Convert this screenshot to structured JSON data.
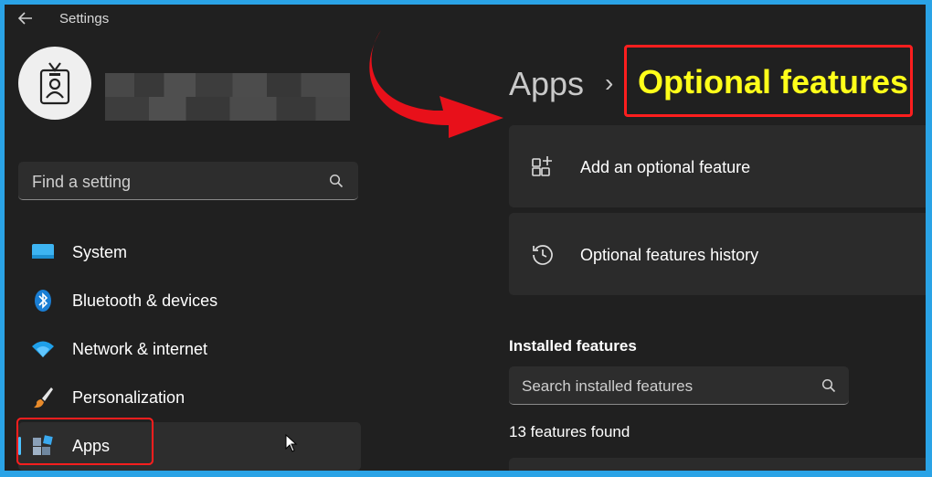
{
  "window": {
    "title": "Settings",
    "back_icon": "arrow-left-icon"
  },
  "user": {
    "avatar_icon": "id-badge-icon"
  },
  "sidebar": {
    "search_placeholder": "Find a setting",
    "items": [
      {
        "label": "System",
        "icon": "monitor-icon",
        "active": false
      },
      {
        "label": "Bluetooth & devices",
        "icon": "bluetooth-icon",
        "active": false
      },
      {
        "label": "Network & internet",
        "icon": "wifi-icon",
        "active": false
      },
      {
        "label": "Personalization",
        "icon": "paintbrush-icon",
        "active": false
      },
      {
        "label": "Apps",
        "icon": "apps-icon",
        "active": true
      }
    ]
  },
  "breadcrumb": {
    "parent": "Apps",
    "separator": "›",
    "current": "Optional features"
  },
  "cards": [
    {
      "label": "Add an optional feature",
      "icon": "add-feature-icon"
    },
    {
      "label": "Optional features history",
      "icon": "history-icon"
    }
  ],
  "installed": {
    "heading": "Installed features",
    "search_placeholder": "Search installed features",
    "count_text": "13 features found"
  },
  "colors": {
    "background": "#202020",
    "card": "#2b2b2b",
    "accent": "#4cc2ff",
    "annotation_red": "#ff1e1e",
    "highlight_yellow": "#ffff1a",
    "frame": "#2aa3e6"
  }
}
